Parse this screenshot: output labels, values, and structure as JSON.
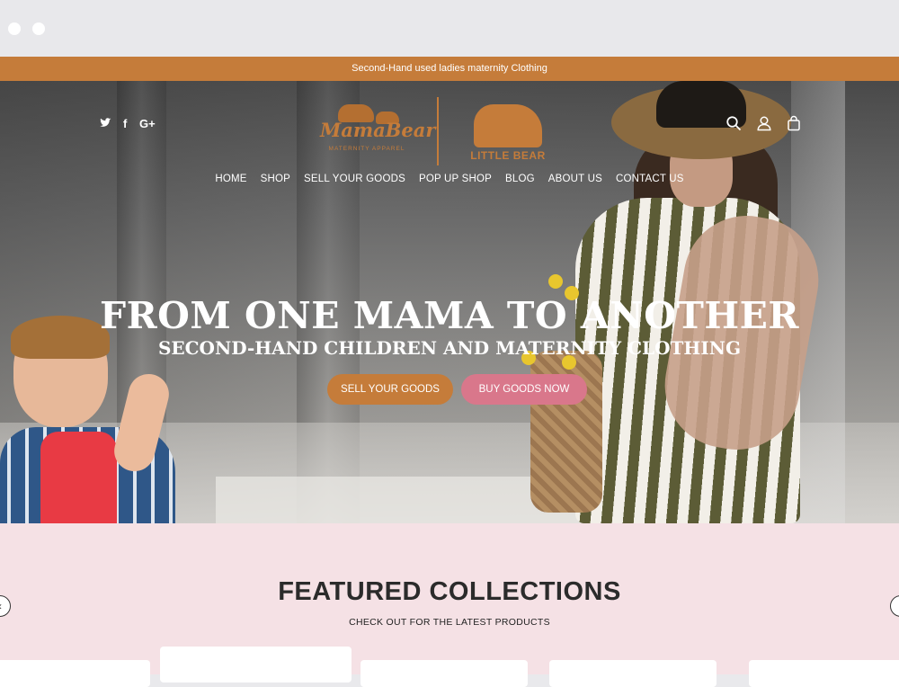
{
  "announcement": "Second-Hand used ladies maternity Clothing",
  "brand": {
    "primary_name": "MamaBear",
    "primary_tagline": "MATERNITY APPAREL",
    "secondary_name": "LITTLE BEAR",
    "accent_color": "#c57c3a"
  },
  "social": {
    "twitter": "𝕥",
    "facebook": "f",
    "google": "G+"
  },
  "nav": [
    "HOME",
    "SHOP",
    "SELL YOUR GOODS",
    "POP UP SHOP",
    "BLOG",
    "ABOUT US",
    "CONTACT US"
  ],
  "hero": {
    "title": "FROM ONE MAMA TO ANOTHER",
    "subtitle": "SECOND-HAND CHILDREN AND MATERNITY CLOTHING",
    "buttons": {
      "sell": "SELL YOUR GOODS",
      "buy": "BUY GOODS NOW"
    }
  },
  "featured": {
    "title": "FEATURED COLLECTIONS",
    "subtitle": "CHECK OUT FOR THE LATEST PRODUCTS"
  },
  "icons": [
    "twitter-icon",
    "facebook-icon",
    "google-plus-icon",
    "search-icon",
    "account-icon",
    "cart-icon",
    "arrow-left-icon",
    "arrow-right-icon"
  ]
}
